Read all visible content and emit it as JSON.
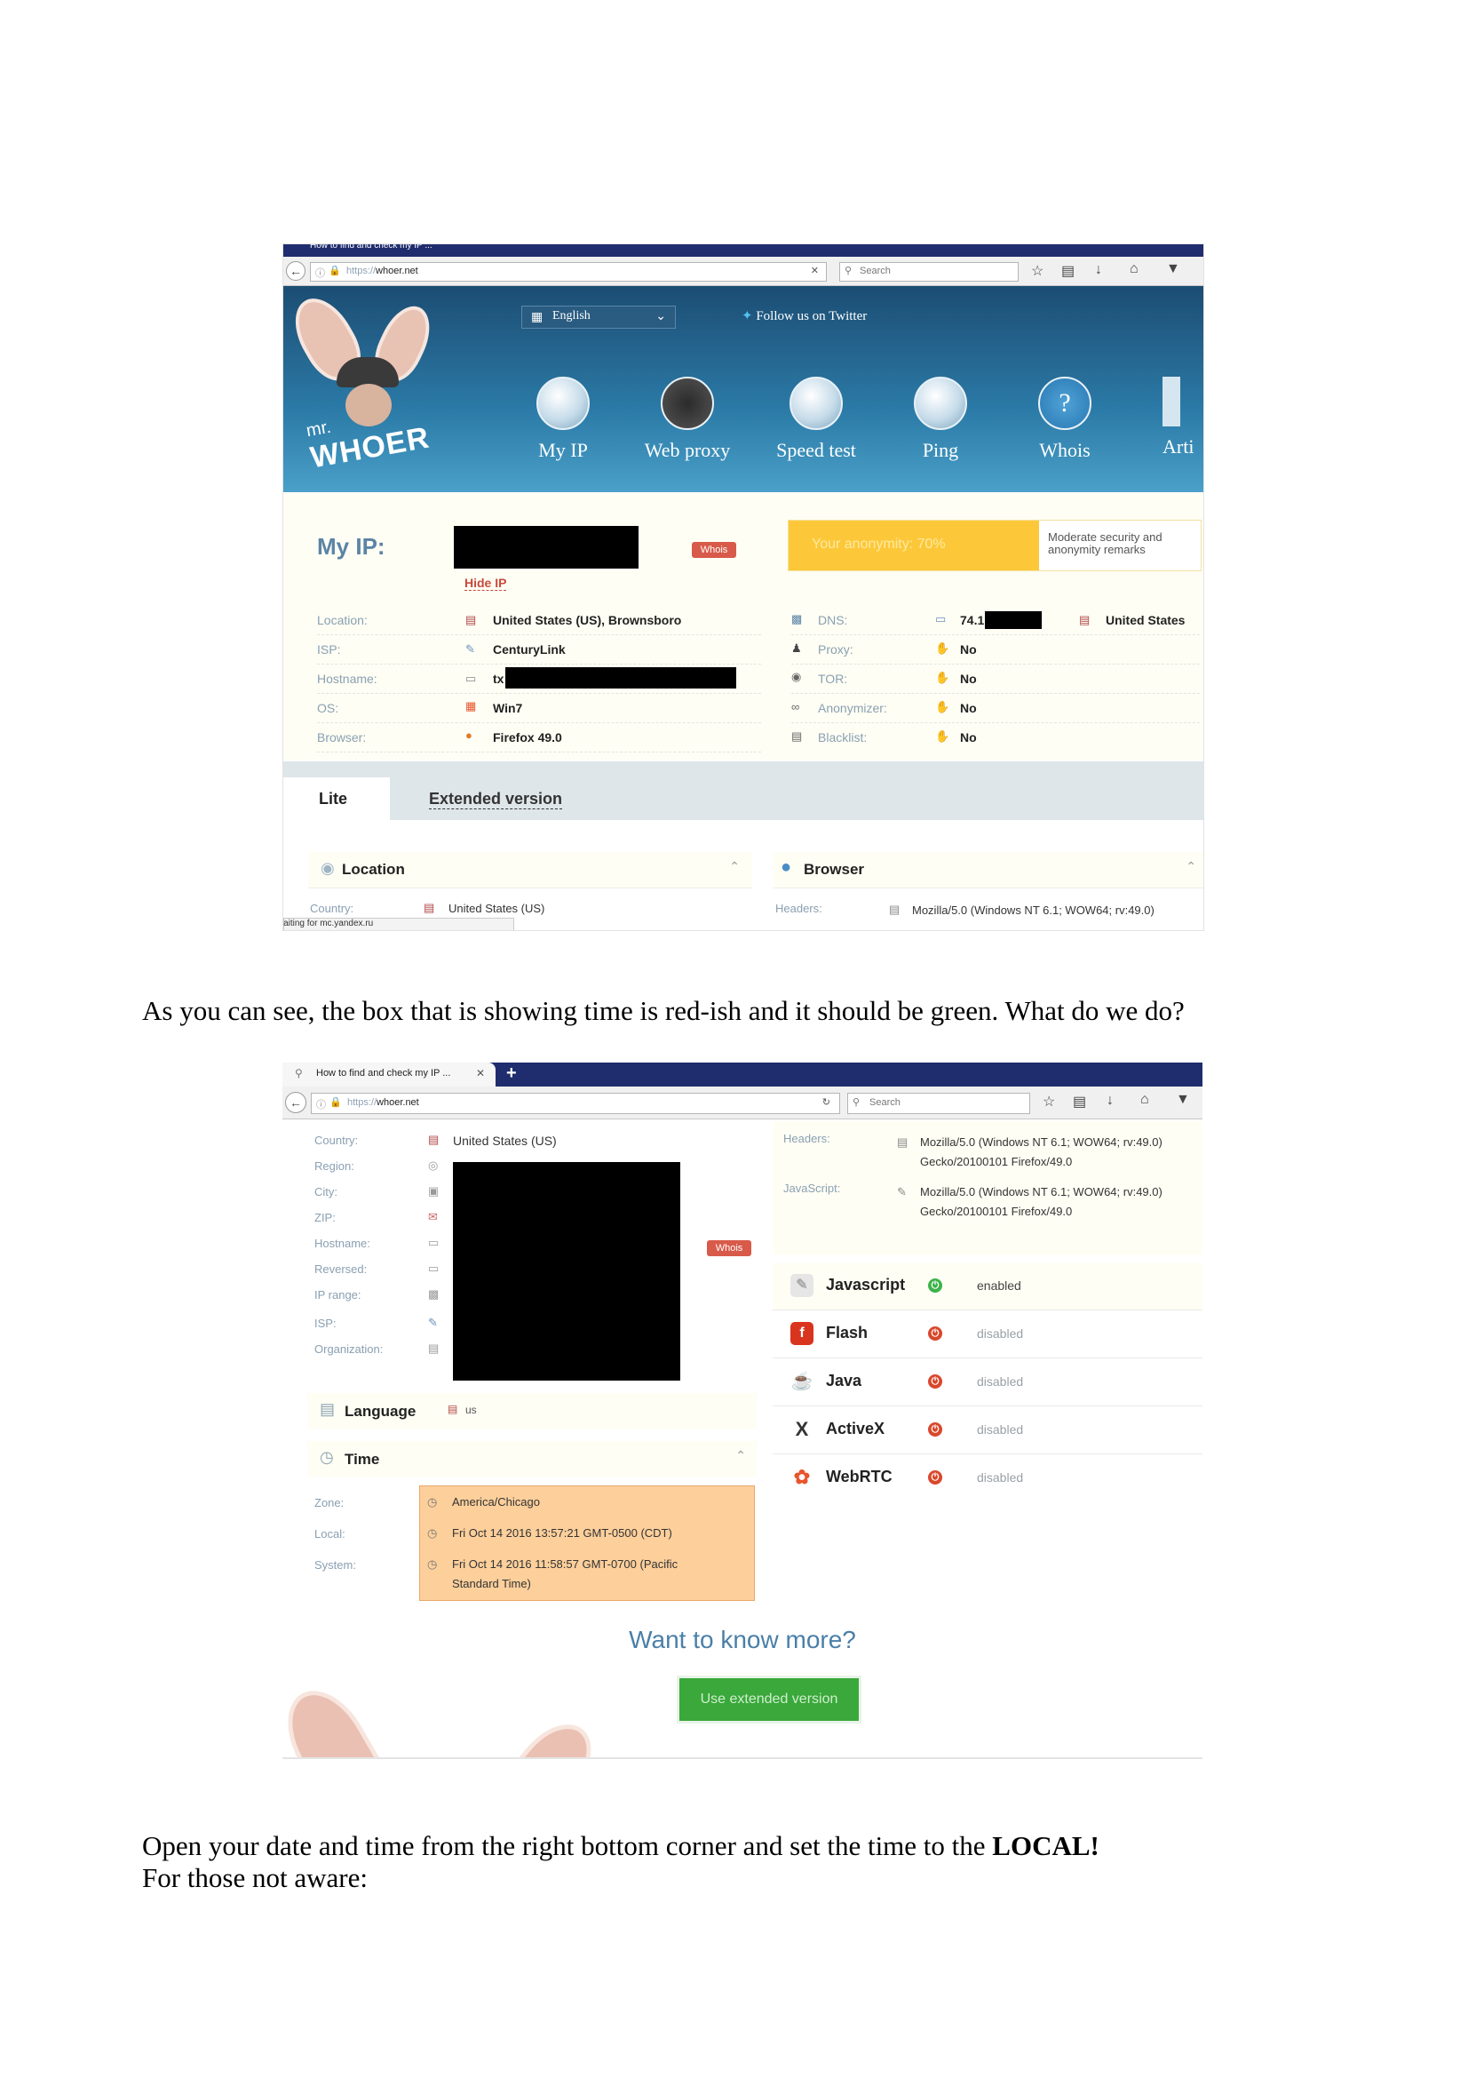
{
  "screenshot1": {
    "tab": {
      "title": "How to find and check my IP ..."
    },
    "url": {
      "prefix": "https://",
      "domain": "whoer.net"
    },
    "search_placeholder": "Search",
    "header": {
      "logo_mr": "mr.",
      "logo_name": "WHOER",
      "language": "English",
      "twitter": "Follow us on Twitter",
      "nav": [
        "My IP",
        "Web proxy",
        "Speed test",
        "Ping",
        "Whois",
        "Arti"
      ]
    },
    "ip": {
      "label": "My IP:",
      "whois_badge": "Whois",
      "hide_ip": "Hide IP",
      "anonymity": "Your anonymity: 70%",
      "remark": "Moderate security and anonymity remarks"
    },
    "left_rows": [
      {
        "label": "Location:",
        "value": "United States (US), Brownsboro"
      },
      {
        "label": "ISP:",
        "value": "CenturyLink"
      },
      {
        "label": "Hostname:",
        "value": "tx"
      },
      {
        "label": "OS:",
        "value": "Win7"
      },
      {
        "label": "Browser:",
        "value": "Firefox 49.0"
      }
    ],
    "right_rows": [
      {
        "label": "DNS:",
        "value": "74.1",
        "extra": "United States"
      },
      {
        "label": "Proxy:",
        "value": "No"
      },
      {
        "label": "TOR:",
        "value": "No"
      },
      {
        "label": "Anonymizer:",
        "value": "No"
      },
      {
        "label": "Blacklist:",
        "value": "No"
      }
    ],
    "tabs": {
      "lite": "Lite",
      "extended": "Extended version"
    },
    "panels": {
      "location": "Location",
      "browser": "Browser",
      "country_label": "Country:",
      "country_value": "United States (US)",
      "headers_label": "Headers:",
      "headers_value": "Mozilla/5.0 (Windows NT 6.1; WOW64; rv:49.0)",
      "status": "Waiting for mc.yandex.ru"
    }
  },
  "paragraph1": "As you can see, the box that is showing time is red-ish and it should be green. What do we do?",
  "screenshot2": {
    "tab": {
      "title": "How to find and check my IP ..."
    },
    "url": {
      "prefix": "https://",
      "domain": "whoer.net"
    },
    "search_placeholder": "Search",
    "location_labels": [
      "Country:",
      "Region:",
      "City:",
      "ZIP:",
      "Hostname:",
      "Reversed:",
      "IP range:",
      "ISP:",
      "Organization:"
    ],
    "country_value": "United States (US)",
    "whois_badge": "Whois",
    "headers_label": "Headers:",
    "headers_value": [
      "Mozilla/5.0 (Windows NT 6.1; WOW64; rv:49.0)",
      "Gecko/20100101 Firefox/49.0"
    ],
    "javascript_label": "JavaScript:",
    "javascript_value": [
      "Mozilla/5.0 (Windows NT 6.1; WOW64; rv:49.0)",
      "Gecko/20100101 Firefox/49.0"
    ],
    "plugins": [
      {
        "name": "Javascript",
        "status": "enabled",
        "color": "#3cb34a"
      },
      {
        "name": "Flash",
        "status": "disabled",
        "color": "#d9472b"
      },
      {
        "name": "Java",
        "status": "disabled",
        "color": "#d9472b"
      },
      {
        "name": "ActiveX",
        "status": "disabled",
        "color": "#d9472b"
      },
      {
        "name": "WebRTC",
        "status": "disabled",
        "color": "#d9472b"
      }
    ],
    "language": {
      "label": "Language",
      "value": "us"
    },
    "time": {
      "label": "Time",
      "zone_label": "Zone:",
      "zone": "America/Chicago",
      "local_label": "Local:",
      "local": "Fri Oct 14 2016 13:57:21 GMT-0500 (CDT)",
      "system_label": "System:",
      "system_line1": "Fri Oct 14 2016 11:58:57 GMT-0700 (Pacific",
      "system_line2": "Standard Time)",
      "box_color": "#fccf9b"
    },
    "more": {
      "title": "Want to know more?",
      "button": "Use extended version"
    }
  },
  "paragraph2": {
    "text": "Open your date and time from the right bottom corner and set the time to the ",
    "bold": "LOCAL!",
    "line2": "For those not aware:"
  }
}
